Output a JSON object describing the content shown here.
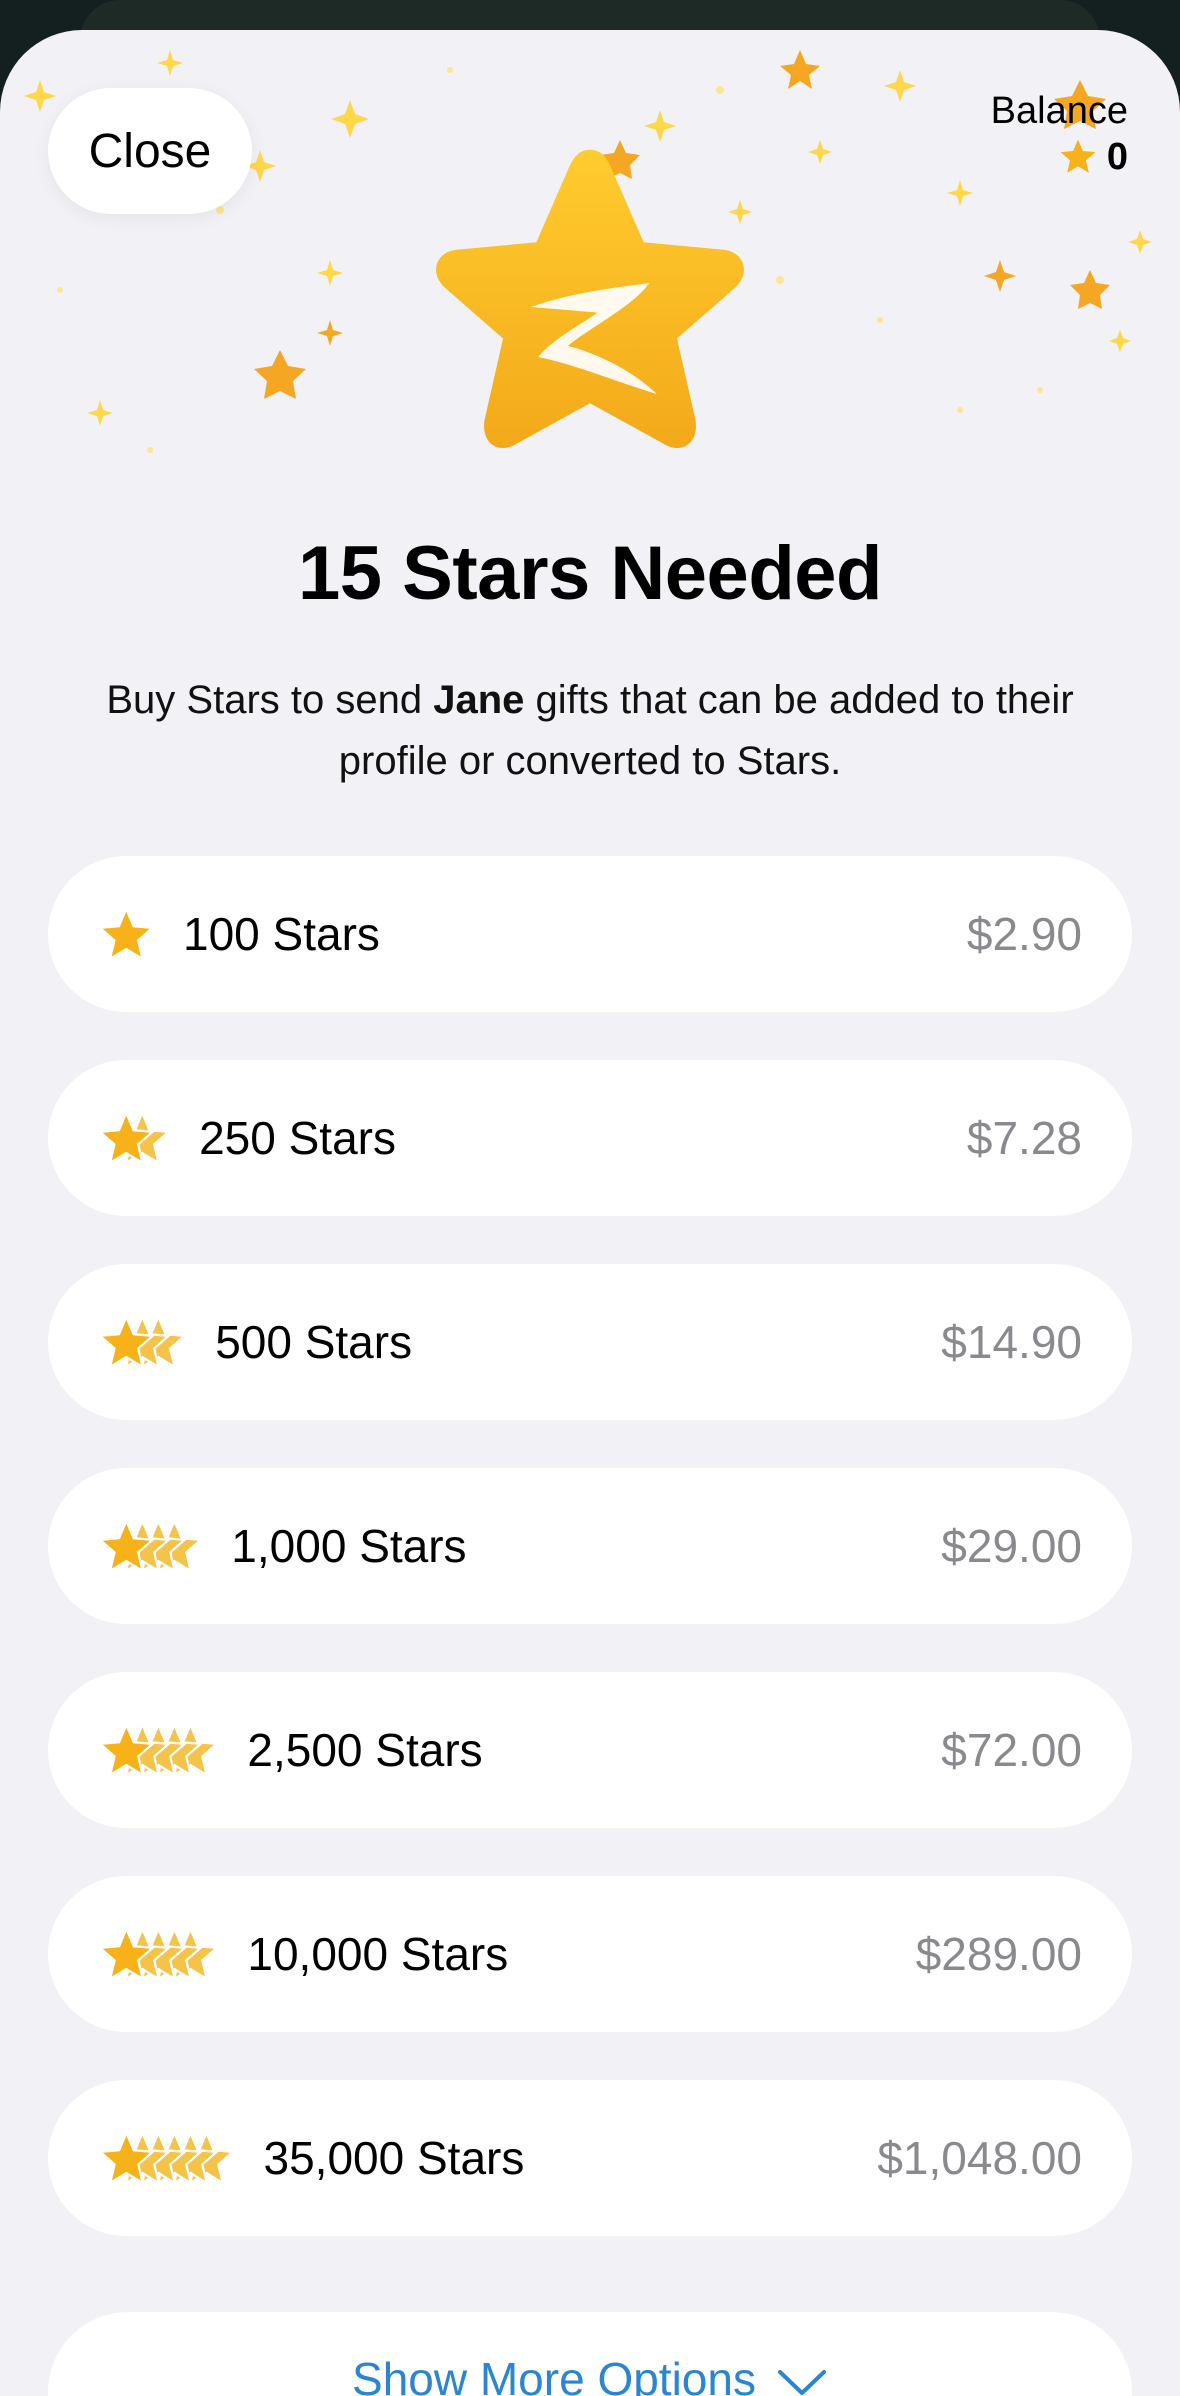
{
  "header": {
    "close_label": "Close",
    "balance_label": "Balance",
    "balance_value": "0"
  },
  "hero": {
    "icon": "telegram-star-icon",
    "title": "15 Stars Needed",
    "subtitle_before": "Buy Stars to send ",
    "subtitle_name": "Jane",
    "subtitle_after": " gifts that can be added to their profile or converted to Stars."
  },
  "options": [
    {
      "label": "100 Stars",
      "price": "$2.90",
      "stack": 1
    },
    {
      "label": "250 Stars",
      "price": "$7.28",
      "stack": 2
    },
    {
      "label": "500 Stars",
      "price": "$14.90",
      "stack": 3
    },
    {
      "label": "1,000 Stars",
      "price": "$29.00",
      "stack": 4
    },
    {
      "label": "2,500 Stars",
      "price": "$72.00",
      "stack": 5
    },
    {
      "label": "10,000 Stars",
      "price": "$289.00",
      "stack": 5
    },
    {
      "label": "35,000 Stars",
      "price": "$1,048.00",
      "stack": 6
    }
  ],
  "more": {
    "label": "Show More Options",
    "icon": "chevron-down-icon"
  },
  "colors": {
    "accent": "#2a86d4",
    "star": "#f7b21a",
    "price": "#8a8a8e",
    "background": "#f1f1f6"
  }
}
